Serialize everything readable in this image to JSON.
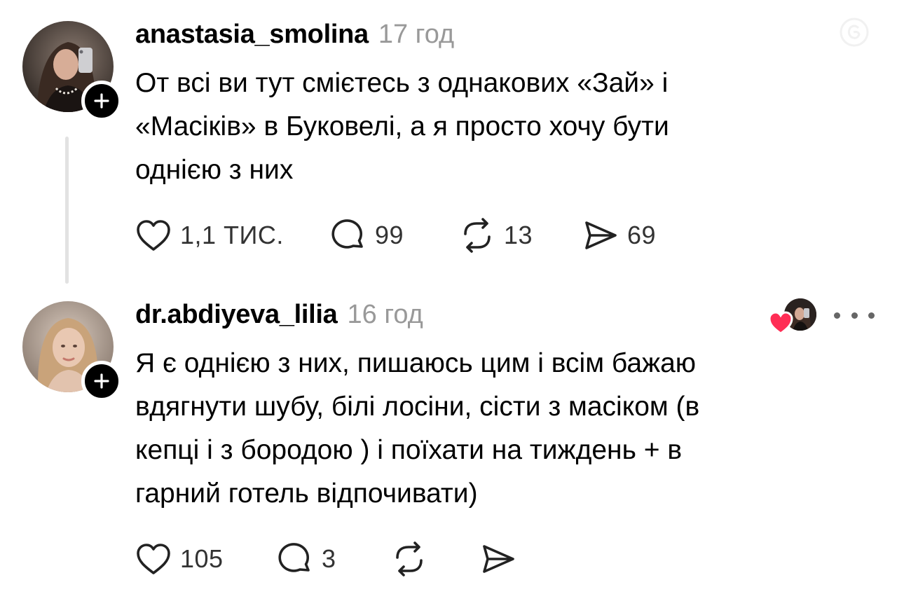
{
  "thread": [
    {
      "username": "anastasia_smolina",
      "time": "17 год",
      "text": "От всі ви тут смієтесь з однакових «Зай» і\n«Масіків» в Буковелі, а я просто хочу бути\nоднією з них",
      "likes": "1,1 тис.",
      "replies": "99",
      "reposts": "13",
      "shares": "69"
    },
    {
      "username": "dr.abdiyeva_lilia",
      "time": "16 год",
      "text": "Я є однією з них, пишаюсь цим і всім бажаю\nвдягнути шубу, білі лосіни, сісти з масіком (в\nкепці і з бородою ) і поїхати на тиждень + в\nгарний готель відпочивати)",
      "likes": "105",
      "replies": "3"
    }
  ],
  "colors": {
    "text": "#000000",
    "muted": "#999999",
    "thread_line": "#e2e2e2",
    "heart": "#ff2d55"
  },
  "icons": [
    "follow-plus-icon",
    "heart-icon",
    "comment-icon",
    "repost-icon",
    "share-icon",
    "more-icon"
  ]
}
